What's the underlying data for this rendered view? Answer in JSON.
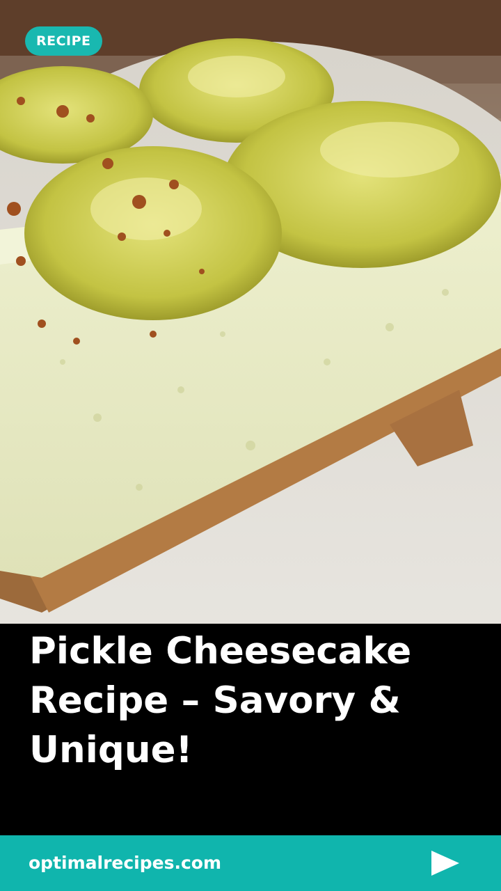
{
  "badge": {
    "label": "RECIPE"
  },
  "hero": {
    "alt": "Slice of pickle cheesecake topped with pickle slices on a graham cracker crust"
  },
  "title": "Pickle Cheesecake Recipe – Savory & Unique!",
  "footer": {
    "site": "optimalrecipes.com",
    "play_icon": "play-triangle-icon"
  },
  "colors": {
    "accent": "#10b5ad",
    "badge": "#19b8b0",
    "text_bg": "#000000"
  }
}
